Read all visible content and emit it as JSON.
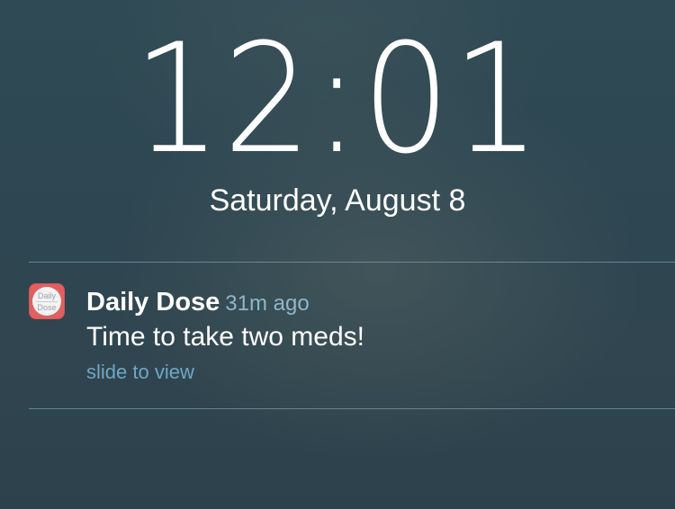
{
  "lockscreen": {
    "time": "12:01",
    "date": "Saturday, August 8"
  },
  "notification": {
    "app_name": "Daily Dose",
    "app_icon": "daily-dose-app-icon",
    "app_icon_text_line1": "Daily",
    "app_icon_text_line2": "Dose",
    "time_ago": "31m ago",
    "message": "Time to take two meds!",
    "action": "slide to view"
  },
  "colors": {
    "background": "#2f4a55",
    "icon_red": "#e35f5f",
    "accent_blue": "#6fa7c4"
  }
}
